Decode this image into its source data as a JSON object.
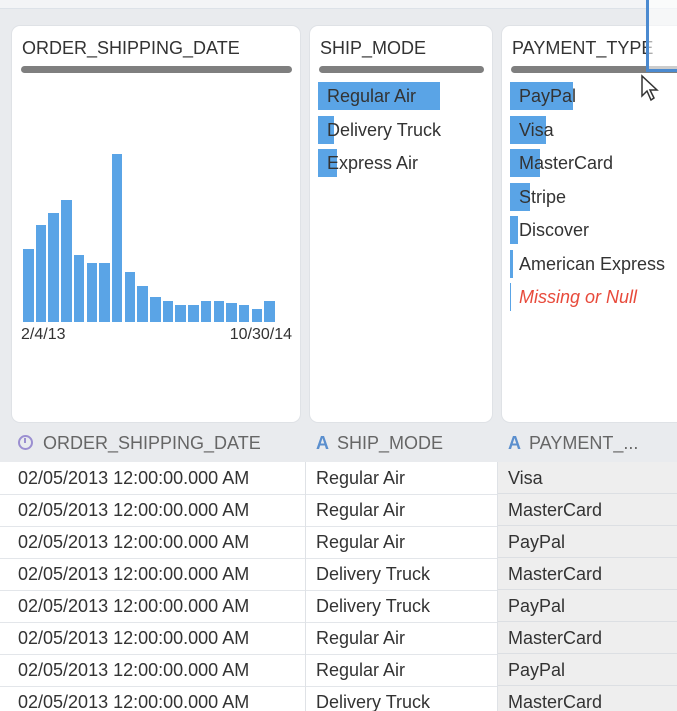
{
  "cards": {
    "order_shipping_date": {
      "title": "ORDER_SHIPPING_DATE",
      "x_start_label": "2/4/13",
      "x_end_label": "10/30/14",
      "histogram_relative_heights": [
        0.35,
        0.46,
        0.52,
        0.58,
        0.32,
        0.28,
        0.28,
        0.8,
        0.24,
        0.17,
        0.12,
        0.1,
        0.08,
        0.08,
        0.1,
        0.1,
        0.09,
        0.08,
        0.06,
        0.1
      ]
    },
    "ship_mode": {
      "title": "SHIP_MODE",
      "items": [
        {
          "label": "Regular Air",
          "fraction": 0.98
        },
        {
          "label": "Delivery Truck",
          "fraction": 0.13
        },
        {
          "label": "Express Air",
          "fraction": 0.15
        }
      ]
    },
    "payment_type": {
      "title": "PAYMENT_TYPE",
      "items": [
        {
          "label": "PayPal",
          "fraction": 0.38
        },
        {
          "label": "Visa",
          "fraction": 0.22
        },
        {
          "label": "MasterCard",
          "fraction": 0.18
        },
        {
          "label": "Stripe",
          "fraction": 0.12
        },
        {
          "label": "Discover",
          "fraction": 0.05
        },
        {
          "label": "American Express",
          "fraction": 0.02
        },
        {
          "label": "Missing or Null",
          "fraction": 0.0,
          "missing": true
        }
      ]
    }
  },
  "columns": [
    {
      "label": "ORDER_SHIPPING_DATE",
      "type_icon": "clock-icon"
    },
    {
      "label": "SHIP_MODE",
      "type_icon": "text-type-icon",
      "icon_glyph": "A"
    },
    {
      "label": "PAYMENT_...",
      "type_icon": "text-type-icon",
      "icon_glyph": "A"
    }
  ],
  "rows": [
    [
      "02/05/2013 12:00:00.000 AM",
      "Regular Air",
      "Visa"
    ],
    [
      "02/05/2013 12:00:00.000 AM",
      "Regular Air",
      "MasterCard"
    ],
    [
      "02/05/2013 12:00:00.000 AM",
      "Regular Air",
      "PayPal"
    ],
    [
      "02/05/2013 12:00:00.000 AM",
      "Delivery Truck",
      "MasterCard"
    ],
    [
      "02/05/2013 12:00:00.000 AM",
      "Delivery Truck",
      "PayPal"
    ],
    [
      "02/05/2013 12:00:00.000 AM",
      "Regular Air",
      "MasterCard"
    ],
    [
      "02/05/2013 12:00:00.000 AM",
      "Regular Air",
      "PayPal"
    ],
    [
      "02/05/2013 12:00:00.000 AM",
      "Delivery Truck",
      "MasterCard"
    ]
  ],
  "colors": {
    "bar_blue": "#5aa4e6",
    "missing_red": "#e84a3b",
    "header_bar_gray": "#7f7f7f"
  }
}
